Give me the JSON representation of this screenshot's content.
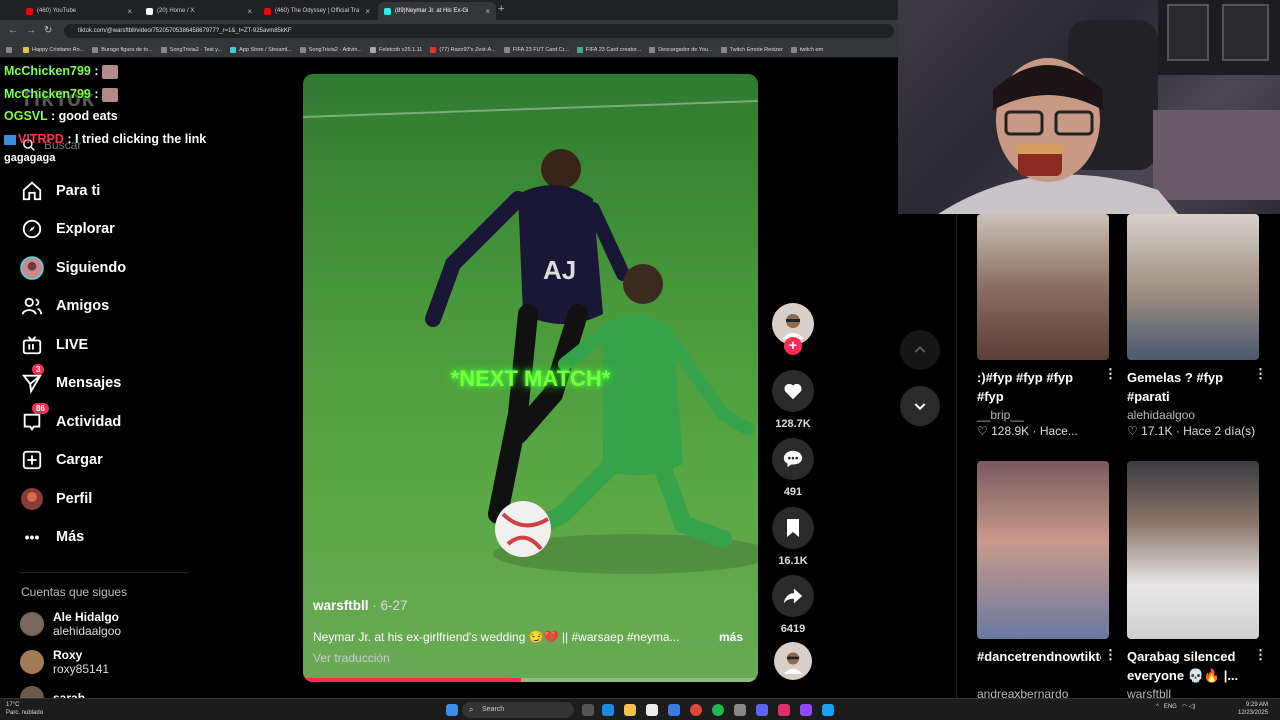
{
  "browser": {
    "tabs": [
      {
        "title": "(460) YouTube",
        "color": "#ff0000"
      },
      {
        "title": "(20) Home / X",
        "color": "#ffffff"
      },
      {
        "title": "(460) The Odyssey | Official Tra",
        "color": "#ff0000"
      },
      {
        "title": "(89)Neymar Jr. at His Ex-Gi",
        "color": "#25f4ee"
      }
    ],
    "url": "tiktok.com/@warsftbll/video/7520570538645867977?_r=1&_t=ZT-925avm85kKF",
    "bookmarks": [
      "Happy Cristiano Ro...",
      "Burago figura de to...",
      "SongTrivia2 - Test y...",
      "App Store / Streaml...",
      "SongTrivia2 - Adivin...",
      "Feletcob v25.1.11",
      "(77) Razo97's Zest-A...",
      "FIFA 23 FUT Card Cr...",
      "FIFA 23 Card creator...",
      "Descargador de You...",
      "Twitch Emote Resizer",
      "twitch em"
    ]
  },
  "chat": [
    {
      "user": "McChicken799",
      "msg": ":",
      "color": "#7dff4d"
    },
    {
      "user": "McChicken799",
      "msg": ":",
      "color": "#7dff4d"
    },
    {
      "user": "OGSVL",
      "msg": ": good eats",
      "color": "#7dff4d"
    },
    {
      "user": "VITRPD",
      "msg": ": I tried clicking the link",
      "color": "#ff3344"
    },
    {
      "user": "",
      "msg": "gagagaga",
      "color": "#ffffff"
    }
  ],
  "tiktok": {
    "logo": "TikTok",
    "search_placeholder": "Buscar",
    "nav": [
      {
        "label": "Para ti",
        "icon": "home-icon"
      },
      {
        "label": "Explorar",
        "icon": "compass-icon"
      },
      {
        "label": "Siguiendo",
        "icon": "following-avatar-icon"
      },
      {
        "label": "Amigos",
        "icon": "friends-icon"
      },
      {
        "label": "LIVE",
        "icon": "live-tv-icon"
      },
      {
        "label": "Mensajes",
        "icon": "send-icon",
        "badge": "3"
      },
      {
        "label": "Actividad",
        "icon": "inbox-icon",
        "badge": "86"
      },
      {
        "label": "Cargar",
        "icon": "upload-icon"
      },
      {
        "label": "Perfil",
        "icon": "profile-avatar-icon"
      },
      {
        "label": "Más",
        "icon": "more-icon"
      }
    ],
    "following_heading": "Cuentas que sigues",
    "following": [
      {
        "name": "Ale Hidalgo",
        "handle": "alehidaalgoo"
      },
      {
        "name": "Roxy",
        "handle": "roxy85141"
      },
      {
        "name": "sarah",
        "handle": ""
      }
    ]
  },
  "video": {
    "overlay_text": "*NEXT MATCH*",
    "author": "warsftbll",
    "date": " · 6-27",
    "caption": "Neymar Jr. at his ex-girlfriend's wedding 😏💔 || #warsaep #neyma...",
    "more": "más",
    "translate": "Ver traducción",
    "progress": 0.48,
    "likes": "128.7K",
    "comments": "491",
    "saves": "16.1K",
    "shares": "6419"
  },
  "recommended": [
    {
      "title": ":)#fyp #fyp #fyp #fyp",
      "user": "__brip__",
      "likes": "128.9K",
      "time": "Hace...",
      "color": "#8a6e62"
    },
    {
      "title": "Gemelas ? #fyp #parati",
      "user": "alehidaalgoo",
      "likes": "17.1K",
      "time": "Hace 2 día(s)",
      "color": "#9a8c80"
    },
    {
      "title": "#dancetrendnowtiktok...",
      "user": "andreaxbernardo",
      "likes": "",
      "time": "",
      "color": "#5a4048"
    },
    {
      "title": "Qarabag silenced everyone 💀🔥 |...",
      "user": "warsftbll",
      "likes": "",
      "time": "",
      "color": "#4a4c52"
    }
  ],
  "taskbar": {
    "temp": "17°C",
    "weather": "Parc. nublado",
    "search": "Search",
    "lang": "ENG",
    "time": "9:29 AM",
    "date": "12/23/2025"
  }
}
